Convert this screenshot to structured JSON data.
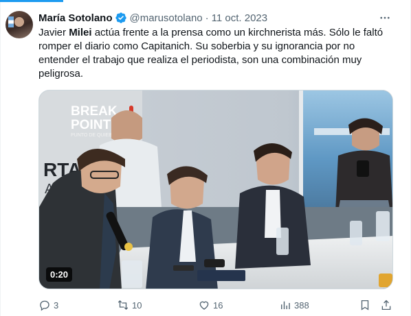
{
  "tweet": {
    "author_name": "María Sotolano",
    "handle": "@marusotolano",
    "separator": "·",
    "date": "11 oct. 2023",
    "text_before": "Javier ",
    "text_bold": "Milei",
    "text_after": " actúa frente a la prensa como un kirchnerista más. Sólo le faltó romper el diario como Capitanich. Su soberbia y su ignorancia por no entender el trabajo que realiza el periodista, son una combinación muy peligrosa."
  },
  "media": {
    "type": "video",
    "timer": "0:20",
    "banner_line1": "BREAK",
    "banner_line2": "POINT",
    "banner_sub": "PUNTO DE QUIEBRE",
    "wall_text_1": "RTAD",
    "wall_text_2": "AVANZ"
  },
  "actions": {
    "replies": "3",
    "reposts": "10",
    "likes": "16",
    "views": "388"
  },
  "colors": {
    "accent": "#1d9bf0",
    "text_secondary": "#536471",
    "verified": "#1d9bf0"
  }
}
